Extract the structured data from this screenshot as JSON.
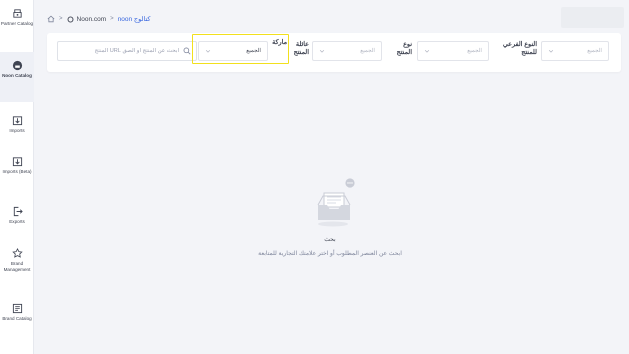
{
  "sidebar": {
    "items": [
      {
        "label": "Partner Catalog",
        "icon": "partner-catalog-icon"
      },
      {
        "label": "Noon Catalog",
        "icon": "noon-catalog-icon",
        "active": true
      },
      {
        "label": "Imports",
        "icon": "import-icon"
      },
      {
        "label": "Imports (Beta)",
        "icon": "import-beta-icon"
      },
      {
        "label": "Exports",
        "icon": "export-icon"
      },
      {
        "label": "Brand Management",
        "icon": "brand-management-icon"
      },
      {
        "label": "Brand Catalog",
        "icon": "brand-catalog-icon"
      }
    ]
  },
  "breadcrumb": {
    "home_icon": "home-icon",
    "separator": ">",
    "site": "Noon.com",
    "current": "كتالوج noon"
  },
  "filters": {
    "search_placeholder": "ابحث عن المنتج أو الصق URL المنتج",
    "brand_label": "ماركة",
    "brand_value": "الجميع",
    "family_label": "عائلة المنتج",
    "family_value": "الجميع",
    "type_label": "نوع المنتج",
    "type_value": "الجميع",
    "subtype_label": "النوع الفرعي للمنتج",
    "subtype_value": "الجميع"
  },
  "empty_state": {
    "title": "بحث",
    "description": "ابحث عن العنصر المطلوب أو اختر علامتك التجارية للمتابعة"
  },
  "colors": {
    "accent": "#3866df",
    "highlight": "#f2e01d",
    "background": "#f3f4f8"
  }
}
